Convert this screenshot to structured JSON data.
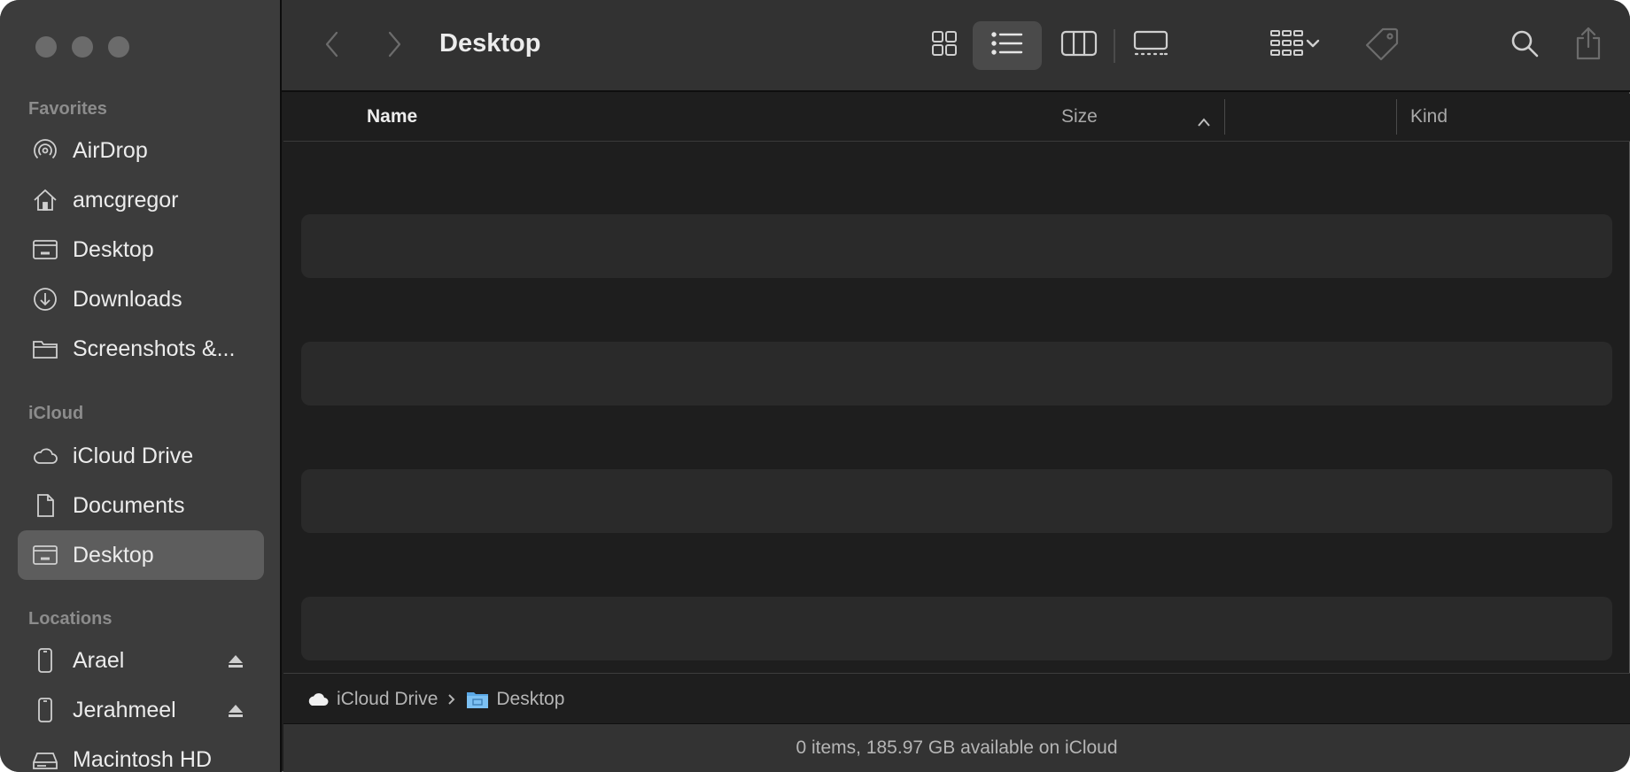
{
  "window": {
    "traffic_lights": [
      "close-button",
      "minimize-button",
      "zoom-button"
    ]
  },
  "sidebar": {
    "sections": [
      {
        "title": "Favorites",
        "items": [
          {
            "label": "AirDrop",
            "icon": "airdrop-icon"
          },
          {
            "label": "amcgregor",
            "icon": "home-icon"
          },
          {
            "label": "Desktop",
            "icon": "desktop-icon"
          },
          {
            "label": "Downloads",
            "icon": "downloads-icon"
          },
          {
            "label": "Screenshots &...",
            "icon": "folder-icon"
          }
        ]
      },
      {
        "title": "iCloud",
        "items": [
          {
            "label": "iCloud Drive",
            "icon": "cloud-icon"
          },
          {
            "label": "Documents",
            "icon": "document-icon"
          },
          {
            "label": "Desktop",
            "icon": "desktop-icon",
            "selected": true
          }
        ]
      },
      {
        "title": "Locations",
        "items": [
          {
            "label": "Arael",
            "icon": "iphone-icon",
            "eject": true
          },
          {
            "label": "Jerahmeel",
            "icon": "iphone-icon",
            "eject": true
          },
          {
            "label": "Macintosh HD",
            "icon": "harddisk-icon"
          }
        ]
      }
    ]
  },
  "toolbar": {
    "title": "Desktop",
    "back_icon": "chevron-left-icon",
    "forward_icon": "chevron-right-icon",
    "views": [
      "icon-view",
      "list-view",
      "column-view",
      "gallery-view"
    ],
    "selected_view": "list-view",
    "group_icon": "group-by-icon",
    "tag_icon": "tag-icon",
    "search_icon": "search-icon",
    "share_icon": "share-icon"
  },
  "columns": {
    "name": "Name",
    "size": "Size",
    "kind": "Kind",
    "sort": "ascending"
  },
  "files": [],
  "pathbar": {
    "items": [
      {
        "label": "iCloud Drive",
        "icon": "cloud-icon"
      },
      {
        "label": "Desktop",
        "icon": "desktop-folder-icon"
      }
    ]
  },
  "status": {
    "text": "0 items, 185.97 GB available on iCloud"
  },
  "colors": {
    "sidebar_bg": "#3c3c3c",
    "toolbar_bg": "#323232",
    "content_bg": "#1e1e1e",
    "zebra_row": "#2a2a2a",
    "selected_item": "#5d5d5d",
    "folder_blue": "#5aa8e6"
  }
}
